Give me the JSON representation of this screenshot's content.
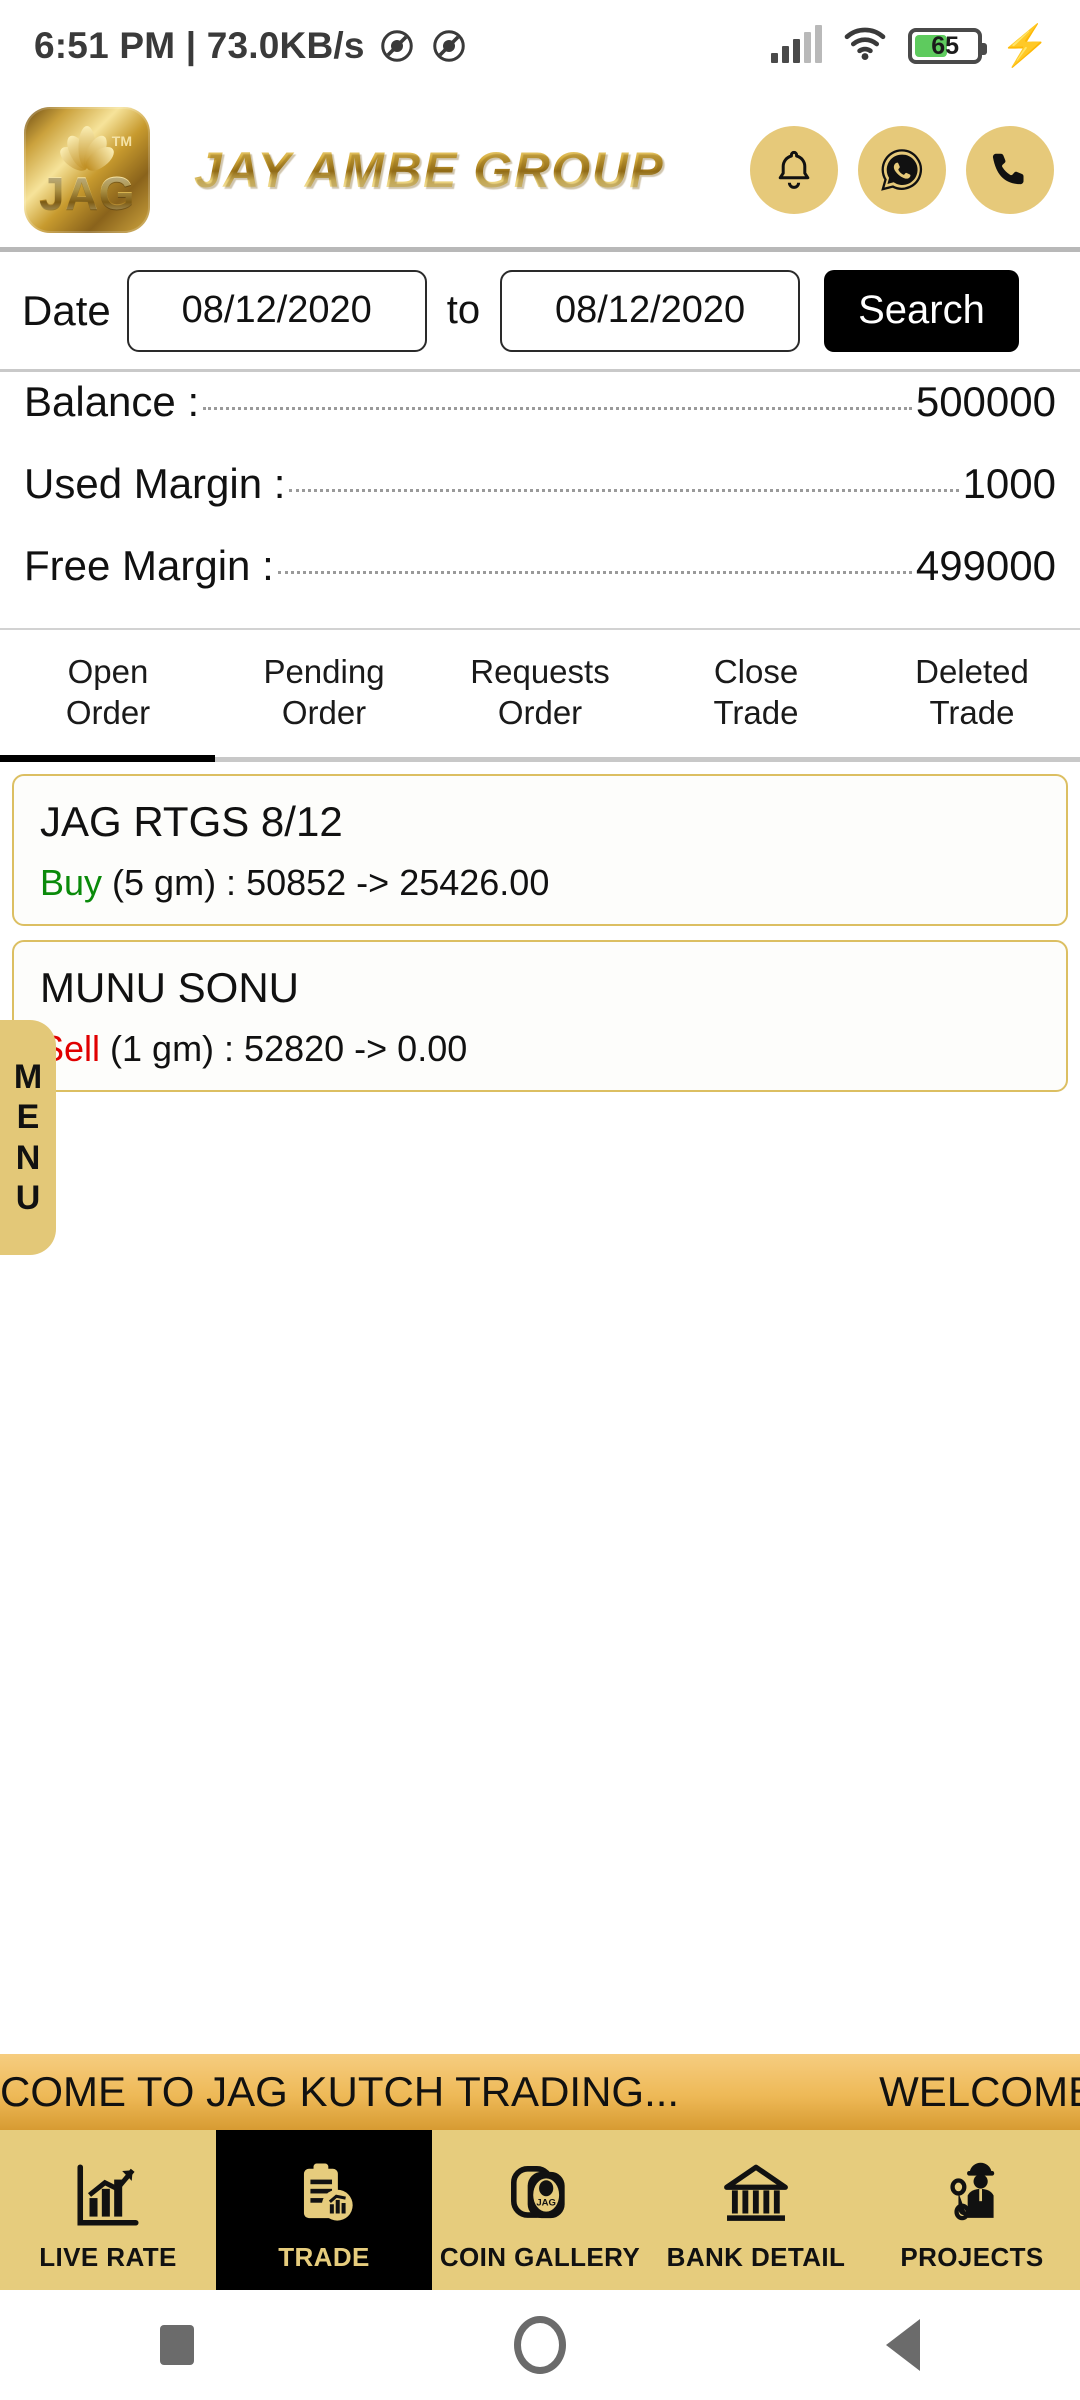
{
  "status_bar": {
    "clock": "6:51 PM | 73.0KB/s",
    "icons_left": [
      "no-sound-icon",
      "no-sound-icon"
    ],
    "signal_icon": "signal-bars-icon",
    "wifi_icon": "wifi-icon",
    "battery_level": "65",
    "charging_icon": "lightning-bolt-icon"
  },
  "header": {
    "logo_text": "JAG",
    "logo_tm": "TM",
    "brand": "JAY AMBE GROUP",
    "actions": [
      {
        "name": "notification-bell-button",
        "icon": "bell-icon"
      },
      {
        "name": "whatsapp-button",
        "icon": "whatsapp-icon"
      },
      {
        "name": "call-button",
        "icon": "phone-icon"
      }
    ],
    "accent_gold": "#e6c97a"
  },
  "date_filter": {
    "label": "Date",
    "from_value": "08/12/2020",
    "to_label": "to",
    "to_value": "08/12/2020",
    "search_label": "Search"
  },
  "account": {
    "rows": [
      {
        "label": "Balance :",
        "value": "500000"
      },
      {
        "label": "Used Margin :",
        "value": "1000"
      },
      {
        "label": "Free Margin :",
        "value": "499000"
      }
    ]
  },
  "tabs": {
    "active_index": 0,
    "items": [
      {
        "line1": "Open",
        "line2": "Order"
      },
      {
        "line1": "Pending",
        "line2": "Order"
      },
      {
        "line1": "Requests",
        "line2": "Order"
      },
      {
        "line1": "Close",
        "line2": "Trade"
      },
      {
        "line1": "Deleted",
        "line2": "Trade"
      }
    ]
  },
  "orders": [
    {
      "title": "JAG RTGS  8/12",
      "side": "Buy",
      "side_color": "#0a8a0a",
      "detail": " (5 gm) : 50852 -> 25426.00"
    },
    {
      "title": "MUNU SONU",
      "side": "Sell",
      "side_color": "#e00000",
      "detail": " (1 gm) : 52820 -> 0.00"
    }
  ],
  "menu_tab": {
    "letters": [
      "M",
      "E",
      "N",
      "U"
    ]
  },
  "marquee": {
    "text_1": "COME TO JAG KUTCH TRADING...",
    "text_2": "WELCOME"
  },
  "bottom_nav": {
    "active_index": 1,
    "items": [
      {
        "label": "LIVE RATE",
        "icon": "chart-growth-icon"
      },
      {
        "label": "TRADE",
        "icon": "clipboard-chart-icon"
      },
      {
        "label": "COIN GALLERY",
        "icon": "coin-jag-icon"
      },
      {
        "label": "BANK DETAIL",
        "icon": "bank-building-icon"
      },
      {
        "label": "PROJECTS",
        "icon": "engineer-icon"
      }
    ],
    "background": "#e6cc7d"
  },
  "system_nav": {
    "recents": "square-icon",
    "home": "circle-icon",
    "back": "triangle-back-icon"
  }
}
